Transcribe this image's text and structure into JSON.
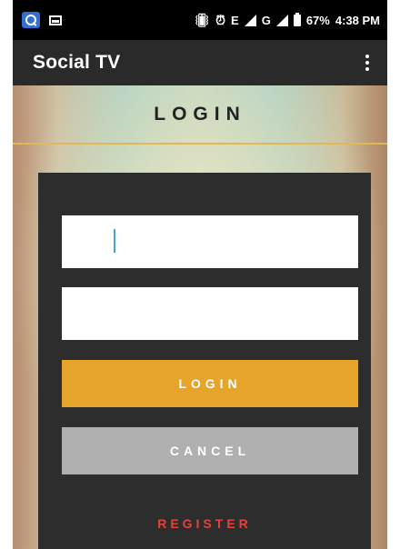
{
  "status_bar": {
    "left_icons": [
      "search-app-icon",
      "image-notification-icon"
    ],
    "right_icons": [
      "vibrate-icon",
      "alarm-icon",
      "signal-icon",
      "signal-icon",
      "battery-icon"
    ],
    "network_e": "E",
    "network_g": "G",
    "battery": "67%",
    "time": "4:38 PM"
  },
  "app_bar": {
    "title": "Social TV",
    "menu_icon": "overflow-menu-icon"
  },
  "login_header": {
    "title": "LOGIN"
  },
  "form": {
    "username_value": "",
    "password_value": "",
    "login_label": "LOGIN",
    "cancel_label": "CANCEL",
    "register_label": "REGISTER"
  },
  "colors": {
    "login_button": "#e6a42a",
    "cancel_button": "#b0b0b0",
    "register_text": "#e0443a",
    "panel": "#2d2d2d",
    "app_bar": "#2a2a2a",
    "header_rule": "#e2b75a"
  }
}
